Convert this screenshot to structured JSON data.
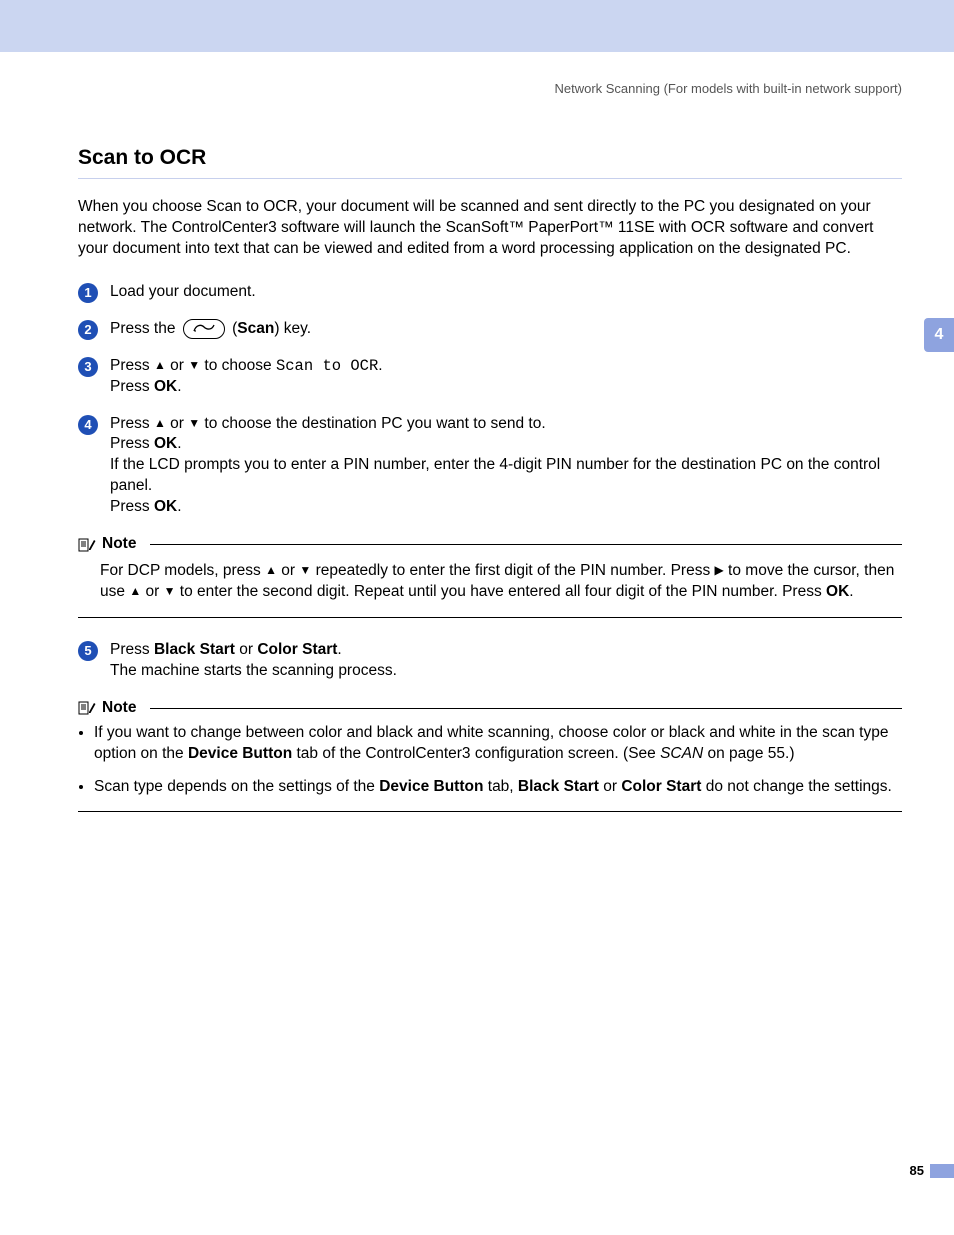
{
  "header": "Network Scanning (For models with built-in network support)",
  "title": "Scan to OCR",
  "intro": "When you choose Scan to OCR, your document will be scanned and sent directly to the PC you designated on your network. The ControlCenter3 software will launch the ScanSoft™ PaperPort™ 11SE with OCR software and convert your document into text that can be viewed and edited from a word processing application on the designated PC.",
  "side_tab": "4",
  "steps": {
    "s1": "Load your document.",
    "s2_a": "Press the ",
    "s2_b": " (",
    "s2_scan": "Scan",
    "s2_c": ") key.",
    "s3_a": "Press ",
    "s3_b": " or ",
    "s3_c": " to choose ",
    "s3_code": "Scan to OCR",
    "s3_d": ".",
    "s3_e": "Press ",
    "s3_ok": "OK",
    "s3_f": ".",
    "s4_a": "Press ",
    "s4_b": " or ",
    "s4_c": " to choose the destination PC you want to send to.",
    "s4_d": "Press ",
    "s4_ok1": "OK",
    "s4_e": ".",
    "s4_f": "If the LCD prompts you to enter a PIN number, enter the 4-digit PIN number for the destination PC on the control panel.",
    "s4_g": "Press ",
    "s4_ok2": "OK",
    "s4_h": ".",
    "s5_a": "Press ",
    "s5_black": "Black Start",
    "s5_b": " or ",
    "s5_color": "Color Start",
    "s5_c": ".",
    "s5_d": "The machine starts the scanning process."
  },
  "note_label": "Note",
  "note1": {
    "a": "For DCP models, press ",
    "b": " or ",
    "c": " repeatedly to enter the first digit of the PIN number. Press ",
    "d": " to move the cursor, then use ",
    "e": " or ",
    "f": " to enter the second digit. Repeat until you have entered all four digit of the PIN number. Press ",
    "ok": "OK",
    "g": "."
  },
  "note2": {
    "li1_a": "If you want to change between color and black and white scanning, choose color or black and white in the scan type option on the ",
    "li1_b": "Device Button",
    "li1_c": " tab of the ControlCenter3 configuration screen. (See ",
    "li1_scan": "SCAN",
    "li1_d": " on page 55.)",
    "li2_a": "Scan type depends on the settings of the ",
    "li2_b": "Device Button",
    "li2_c": " tab, ",
    "li2_d": "Black Start",
    "li2_e": " or ",
    "li2_f": "Color Start",
    "li2_g": " do not change the settings."
  },
  "page_number": "85"
}
